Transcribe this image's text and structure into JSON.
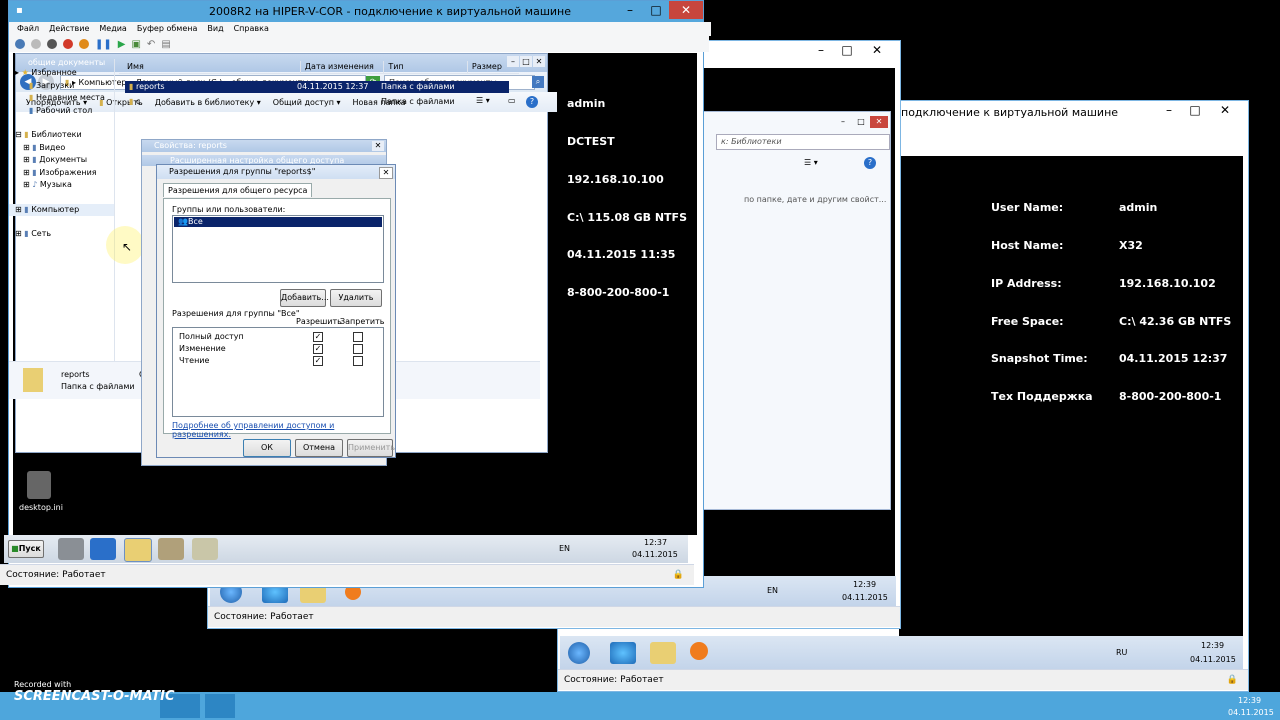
{
  "vm_window_right": {
    "title": "подключение к виртуальной машине",
    "info": [
      {
        "label": "User Name:",
        "value": "admin"
      },
      {
        "label": "Host Name:",
        "value": "X32"
      },
      {
        "label": "IP Address:",
        "value": "192.168.10.102"
      },
      {
        "label": "Free Space:",
        "value": "C:\\ 42.36 GB NTFS"
      },
      {
        "label": "Snapshot Time:",
        "value": "04.11.2015 12:37"
      },
      {
        "label": "Тех Поддержка",
        "value": "8-800-200-800-1"
      }
    ],
    "lang": "RU",
    "time": "12:39",
    "date": "04.11.2015",
    "status": "Состояние: Работает"
  },
  "vm_window_middle": {
    "search_placeholder": "к: Библиотеки",
    "hint": "по папке, дате и другим свойст...",
    "lang": "EN",
    "time": "12:39",
    "date": "04.11.2015",
    "status": "Состояние: Работает"
  },
  "vm_window_main": {
    "title": "2008R2 на HIPER-V-COR - подключение к виртуальной машине",
    "menu": [
      "Файл",
      "Действие",
      "Медиа",
      "Буфер обмена",
      "Вид",
      "Справка"
    ],
    "status": "Состояние: Работает",
    "info": [
      "admin",
      "DCTEST",
      "192.168.10.100",
      "C:\\ 115.08 GB NTFS",
      "04.11.2015 11:35",
      "8-800-200-800-1"
    ],
    "desktop_icon": "desktop.ini",
    "start_label": "Пуск",
    "lang": "EN",
    "time": "12:37",
    "date": "04.11.2015"
  },
  "explorer": {
    "title": "общие документы",
    "address": [
      "Компьютер",
      "Локальный диск (C:)",
      "общие документы"
    ],
    "search_placeholder": "Поиск: общие документы",
    "toolbar": [
      "Упорядочить",
      "Открыть",
      "Добавить в библиотеку",
      "Общий доступ",
      "Новая папка"
    ],
    "columns": [
      "Имя",
      "Дата изменения",
      "Тип",
      "Размер"
    ],
    "rows": [
      {
        "name": "reports",
        "date": "04.11.2015 12:37",
        "type": "Папка с файлами"
      },
      {
        "name": "с",
        "date": "",
        "type": "Папка с файлами"
      }
    ],
    "tree": {
      "favorites": "Избранное",
      "fav_items": [
        "Загрузки",
        "Недавние места",
        "Рабочий стол"
      ],
      "libraries": "Библиотеки",
      "lib_items": [
        "Видео",
        "Документы",
        "Изображения",
        "Музыка"
      ],
      "computer": "Компьютер",
      "network": "Сеть"
    },
    "details_name": "reports",
    "details_type": "Папка с файлами",
    "details_extra": "С"
  },
  "props_dialog": {
    "title": "Свойства: reports",
    "subtitle": "Расширенная настройка общего доступа"
  },
  "perm_dialog": {
    "title": "Разрешения для группы \"reports$\"",
    "tab": "Разрешения для общего ресурса",
    "groups_label": "Группы или пользователи:",
    "group_selected": "Все",
    "add": "Добавить...",
    "remove": "Удалить",
    "perm_label": "Разрешения для группы \"Все\"",
    "allow": "Разрешить",
    "deny": "Запретить",
    "perms": [
      {
        "name": "Полный доступ",
        "allow": true,
        "deny": false
      },
      {
        "name": "Изменение",
        "allow": true,
        "deny": false
      },
      {
        "name": "Чтение",
        "allow": true,
        "deny": false
      }
    ],
    "link": "Подробнее об управлении доступом и разрешениях.",
    "ok": "ОК",
    "cancel": "Отмена",
    "apply": "Применить"
  },
  "host": {
    "watermark_top": "Recorded with",
    "watermark_brand": "SCREENCAST-O-MATIC",
    "time": "12:39",
    "date": "04.11.2015"
  }
}
